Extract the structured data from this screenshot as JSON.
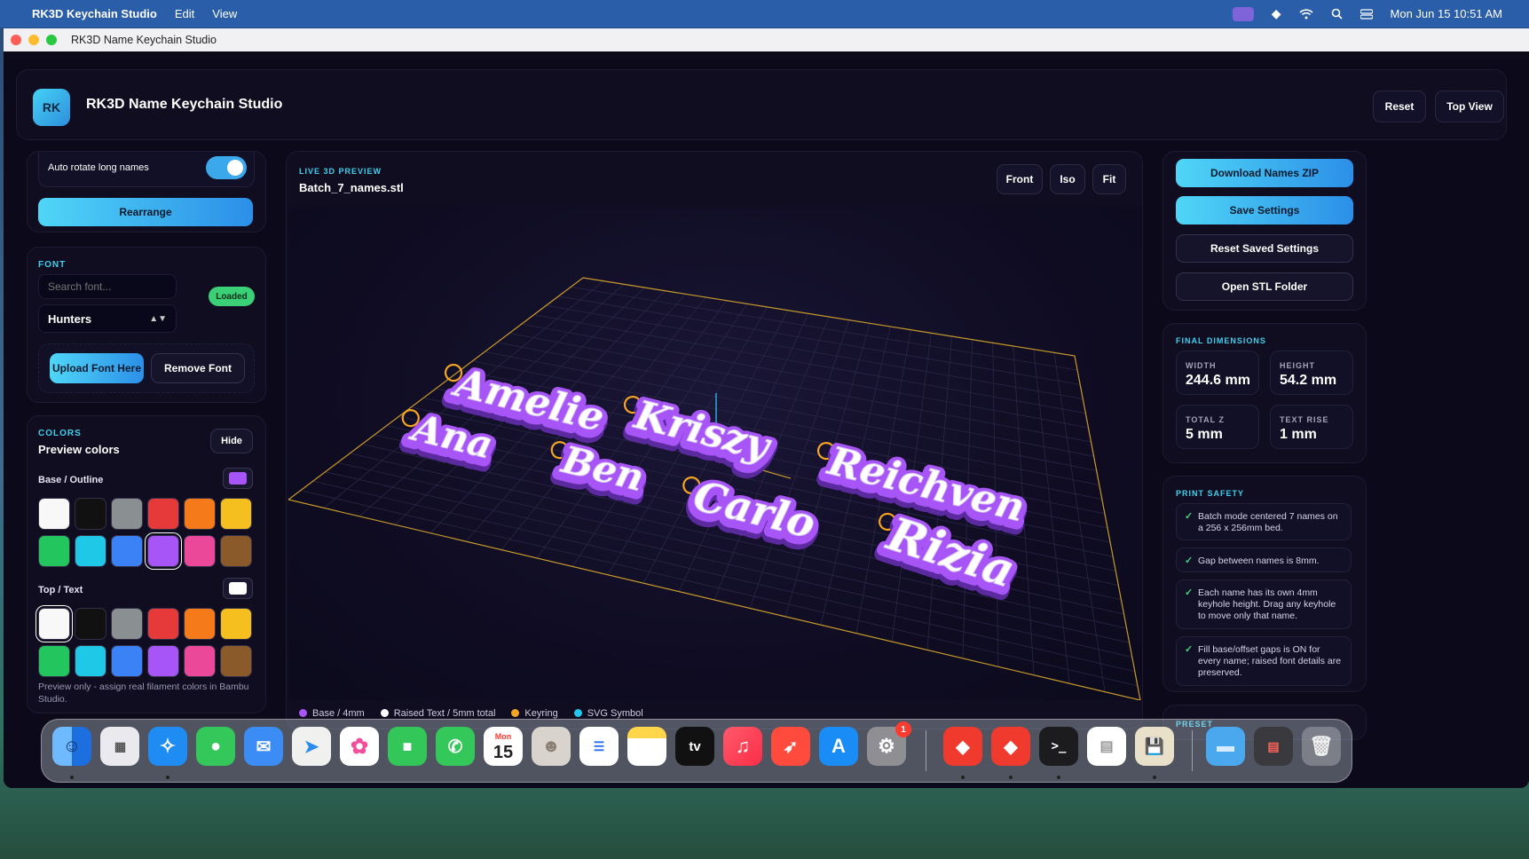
{
  "menubar": {
    "app_name": "RK3D Keychain Studio",
    "menus": [
      "Edit",
      "View"
    ],
    "datetime": "Mon Jun 15  10:51 AM"
  },
  "window": {
    "title": "RK3D Name Keychain Studio"
  },
  "header": {
    "logo_text": "RK",
    "title": "RK3D Name Keychain Studio",
    "reset_label": "Reset",
    "top_view_label": "Top View"
  },
  "left": {
    "auto_rotate_label": "Auto rotate long names",
    "auto_rotate_on": true,
    "rearrange_label": "Rearrange",
    "font": {
      "section_label": "FONT",
      "search_placeholder": "Search font...",
      "status_badge": "Loaded",
      "selected_font": "Hunters",
      "upload_label": "Upload Font Here",
      "remove_label": "Remove Font"
    },
    "colors": {
      "section_label": "COLORS",
      "title": "Preview colors",
      "hide_label": "Hide",
      "base_label": "Base / Outline",
      "base_current": "#a855f7",
      "top_label": "Top / Text",
      "top_current": "#ffffff",
      "palette": [
        "#f8f8f8",
        "#111111",
        "#8a8f92",
        "#e63a3a",
        "#f47a1a",
        "#f5bf1f",
        "#22c55e",
        "#1ec8e6",
        "#3b82f6",
        "#a855f7",
        "#ec4899",
        "#8b5a2b"
      ],
      "base_selected_index": 9,
      "top_selected_index": 0,
      "note": "Preview only - assign real filament colors in Bambu Studio."
    }
  },
  "preview": {
    "section_label": "LIVE 3D PREVIEW",
    "file_name": "Batch_7_names.stl",
    "front_label": "Front",
    "iso_label": "Iso",
    "fit_label": "Fit",
    "names": [
      "Amelie",
      "Kriszy",
      "Ana",
      "Ben",
      "Reichven",
      "Carlo",
      "Rizia"
    ],
    "legend": [
      {
        "label": "Base / 4mm",
        "color": "#a855f7"
      },
      {
        "label": "Raised Text / 5mm total",
        "color": "#ffffff"
      },
      {
        "label": "Keyring",
        "color": "#f5a623"
      },
      {
        "label": "SVG Symbol",
        "color": "#22c7ee"
      }
    ]
  },
  "right": {
    "download_label": "Download Names ZIP",
    "save_label": "Save Settings",
    "reset_saved_label": "Reset Saved Settings",
    "open_folder_label": "Open STL Folder",
    "dimensions": {
      "section_label": "FINAL DIMENSIONS",
      "width_label": "WIDTH",
      "width_value": "244.6 mm",
      "height_label": "HEIGHT",
      "height_value": "54.2 mm",
      "totalz_label": "TOTAL Z",
      "totalz_value": "5 mm",
      "textrise_label": "TEXT RISE",
      "textrise_value": "1 mm"
    },
    "safety": {
      "section_label": "PRINT SAFETY",
      "items": [
        "Batch mode centered 7 names on a 256 x 256mm bed.",
        "Gap between names is 8mm.",
        "Each name has its own 4mm keyhole height. Drag any keyhole to move only that name.",
        "Fill base/offset gaps is ON for every name; raised font details are preserved."
      ]
    },
    "preset_label": "PRESET"
  },
  "dock": {
    "calendar_month": "Mon",
    "calendar_day": "15",
    "settings_badge": "1",
    "tv_label": "tv",
    "terminal_glyph": ">_"
  }
}
